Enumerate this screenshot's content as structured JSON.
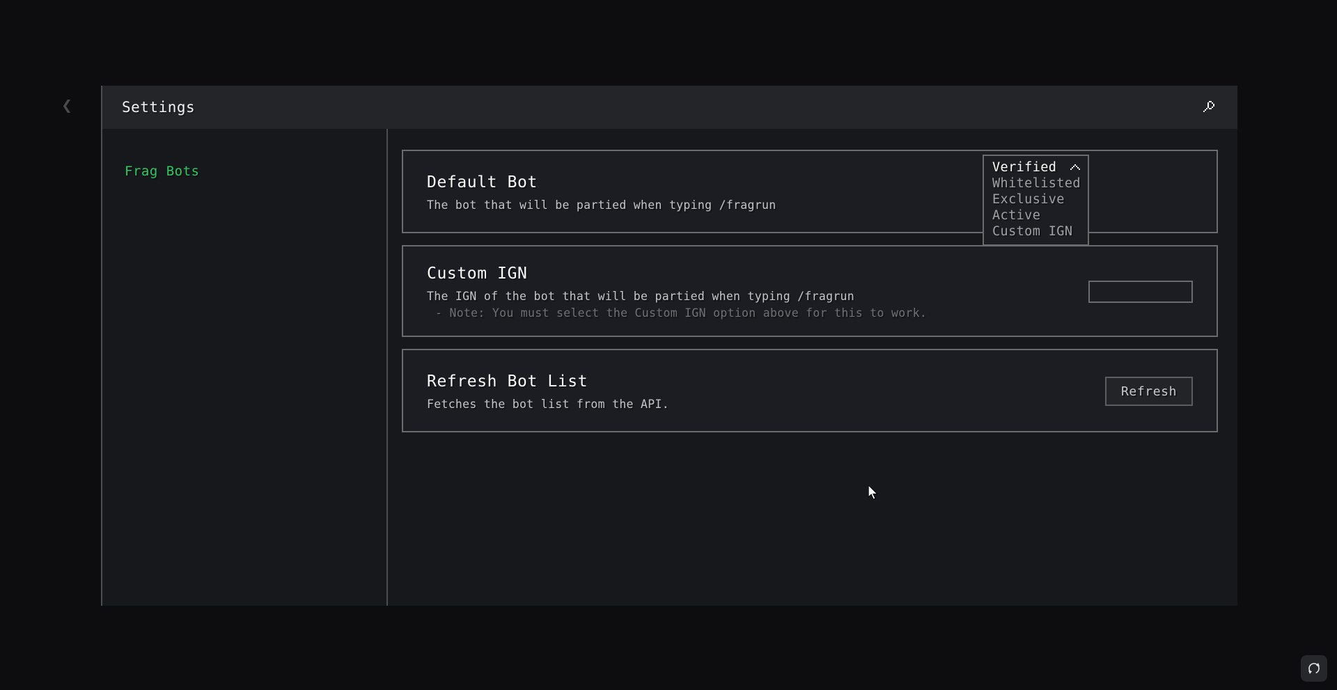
{
  "window": {
    "title": "Settings",
    "back_icon": "chevron-left-icon",
    "search_icon": "search-icon"
  },
  "sidebar": {
    "items": [
      {
        "label": "Frag Bots",
        "active": true
      }
    ]
  },
  "cards": [
    {
      "title": "Default Bot",
      "desc": "The bot that will be partied when typing /fragrun",
      "note": "",
      "control": "dropdown"
    },
    {
      "title": "Custom IGN",
      "desc": "The IGN of the bot that will be partied when typing /fragrun",
      "note": "- Note: You must select the Custom IGN option above for this to work.",
      "control": "text-input"
    },
    {
      "title": "Refresh Bot List",
      "desc": "Fetches the bot list from the API.",
      "note": "",
      "control": "button"
    }
  ],
  "custom_ign_input": {
    "value": "",
    "placeholder": ""
  },
  "refresh_button": {
    "label": "Refresh"
  },
  "dropdown": {
    "open": true,
    "selected": "Verified",
    "chevron_icon": "chevron-up-icon",
    "options": [
      "Verified",
      "Whitelisted",
      "Exclusive",
      "Active",
      "Custom IGN"
    ]
  },
  "corner_badge": {
    "icon": "refresh-circle-icon"
  },
  "colors": {
    "accent_green": "#2cc95f",
    "panel_bg": "#17181b",
    "card_bg": "#1c1d22",
    "card_border": "#6a6b6e",
    "titlebar_bg": "#242528",
    "backdrop": "#0d0d0f"
  }
}
